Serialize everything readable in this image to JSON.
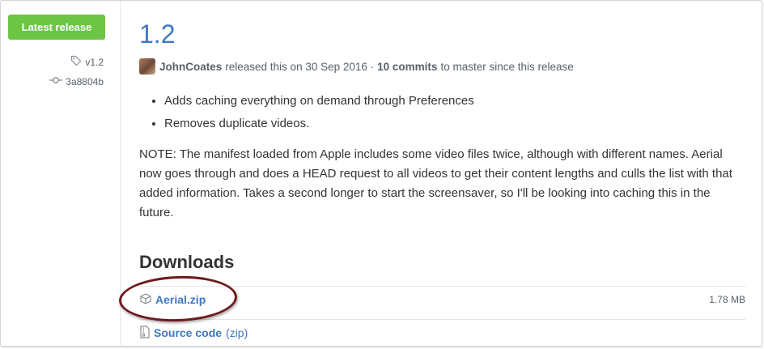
{
  "release": {
    "badge": "Latest release",
    "tag": "v1.2",
    "commit": "3a8804b",
    "title": "1.2",
    "author": "JohnCoates",
    "released_text": "released this on 30 Sep 2016 ·",
    "commits_count": "10 commits",
    "commits_suffix": "to master since this release"
  },
  "notes": {
    "bullets": [
      "Adds caching everything on demand through Preferences",
      "Removes duplicate videos."
    ],
    "paragraph": "NOTE: The manifest loaded from Apple includes some video files twice, although with different names. Aerial now goes through and does a HEAD request to all videos to get their content lengths and culls the list with that added information. Takes a second longer to start the screensaver, so I'll be looking into caching this in the future."
  },
  "downloads": {
    "heading": "Downloads",
    "assets": [
      {
        "name": "Aerial.zip",
        "size": "1.78 MB",
        "icon": "package-icon"
      }
    ],
    "source": {
      "label": "Source code",
      "format": "(zip)",
      "icon": "file-zip-icon"
    }
  },
  "colors": {
    "badge_green": "#6cc644",
    "link_blue": "#4078c0",
    "annotation_red": "#6e1a1f"
  }
}
